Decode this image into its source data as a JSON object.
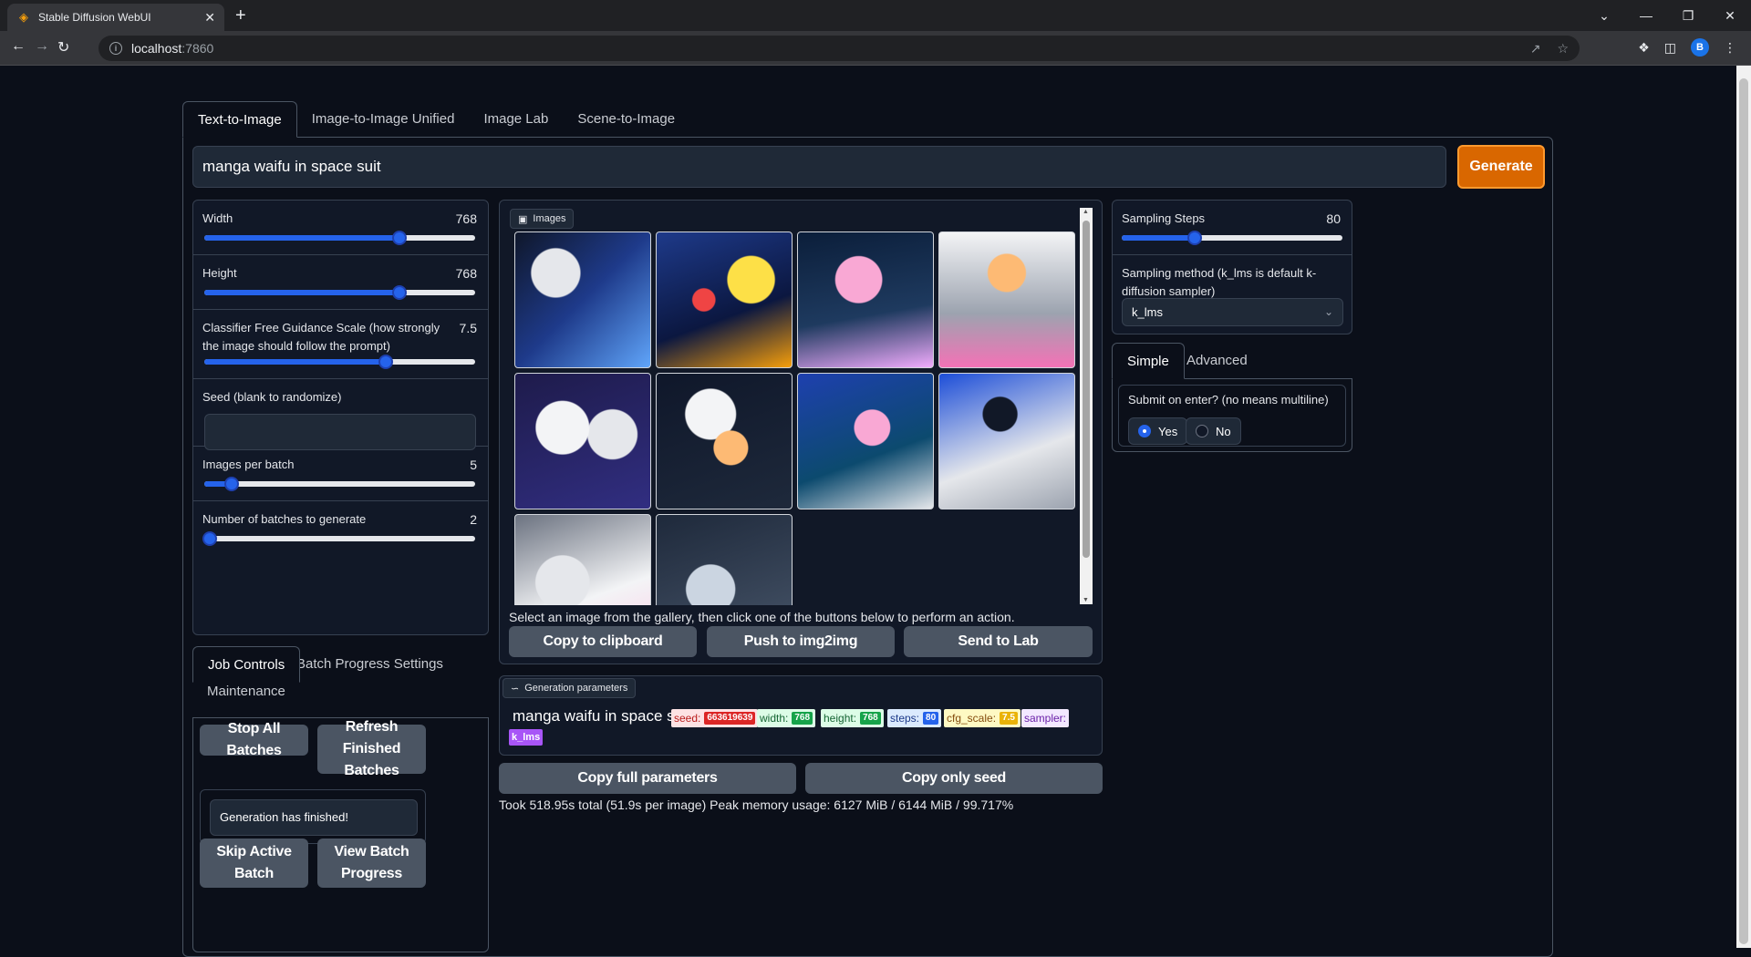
{
  "browser": {
    "tab_title": "Stable Diffusion WebUI",
    "url_host": "localhost",
    "url_port": ":7860",
    "profile_initial": "B"
  },
  "main_tabs": [
    "Text-to-Image",
    "Image-to-Image Unified",
    "Image Lab",
    "Scene-to-Image"
  ],
  "prompt": "manga waifu in space suit",
  "generate_label": "Generate",
  "left": {
    "width": {
      "label": "Width",
      "value": "768",
      "fraction": 0.72
    },
    "height": {
      "label": "Height",
      "value": "768",
      "fraction": 0.72
    },
    "cfg": {
      "label": "Classifier Free Guidance Scale (how strongly the image should follow the prompt)",
      "value": "7.5",
      "fraction": 0.67
    },
    "seed": {
      "label": "Seed (blank to randomize)",
      "value": ""
    },
    "images_per_batch": {
      "label": "Images per batch",
      "value": "5",
      "fraction": 0.1
    },
    "num_batches": {
      "label": "Number of batches to generate",
      "value": "2",
      "fraction": 0.02
    }
  },
  "job_tabs": [
    "Job Controls",
    "Batch Progress Settings",
    "Maintenance"
  ],
  "job": {
    "stop_all": "Stop All Batches",
    "refresh": "Refresh Finished Batches",
    "status": "Generation has finished!",
    "skip": "Skip Active Batch",
    "view": "View Batch Progress"
  },
  "gallery": {
    "label": "Images",
    "hint": "Select an image from the gallery, then click one of the buttons below to perform an action.",
    "copy_clipboard": "Copy to clipboard",
    "push_img2img": "Push to img2img",
    "send_lab": "Send to Lab"
  },
  "gen_params": {
    "label": "Generation parameters",
    "prompt": "manga waifu in space suit",
    "seed_key": "seed:",
    "seed_val": "663619639",
    "width_key": "width:",
    "width_val": "768",
    "height_key": "height:",
    "height_val": "768",
    "steps_key": "steps:",
    "steps_val": "80",
    "cfg_key": "cfg_scale:",
    "cfg_val": "7.5",
    "sampler_key": "sampler:",
    "sampler_val": "k_lms"
  },
  "copy_full": "Copy full parameters",
  "copy_seed": "Copy only seed",
  "footline": "Took 518.95s total (51.9s per image) Peak memory usage: 6127 MiB / 6144 MiB / 99.717%",
  "right": {
    "steps": {
      "label": "Sampling Steps",
      "value": "80",
      "fraction": 0.33
    },
    "method_label": "Sampling method (k_lms is default k-diffusion sampler)",
    "method_value": "k_lms",
    "tabs": [
      "Simple",
      "Advanced"
    ],
    "submit_label": "Submit on enter? (no means multiline)",
    "yes": "Yes",
    "no": "No",
    "selected": "Yes"
  }
}
